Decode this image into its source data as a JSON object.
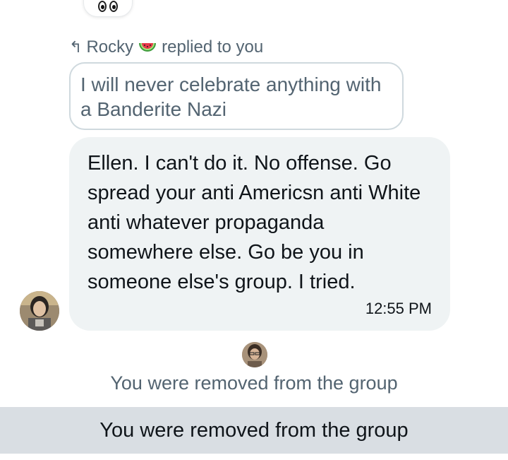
{
  "reaction": {
    "emoji_icon": "eyes-icon"
  },
  "reply_header": {
    "name": "Rocky",
    "emoji_icon": "watermelon-icon",
    "text": "replied to you"
  },
  "quoted_message": {
    "text": "I will never celebrate anything with a Banderite Nazi"
  },
  "message": {
    "text": "Ellen. I can't do it. No offense. Go spread your anti Americsn anti White anti whatever propaganda somewhere else. Go be you in someone else's group. I tried.",
    "time": "12:55 PM"
  },
  "system_message": {
    "text": "You were removed from the group"
  },
  "banner": {
    "text": "You were removed from the group"
  },
  "colors": {
    "bubble": "#eff3f4",
    "secondary_text": "#536471",
    "banner": "#d9dee3"
  }
}
